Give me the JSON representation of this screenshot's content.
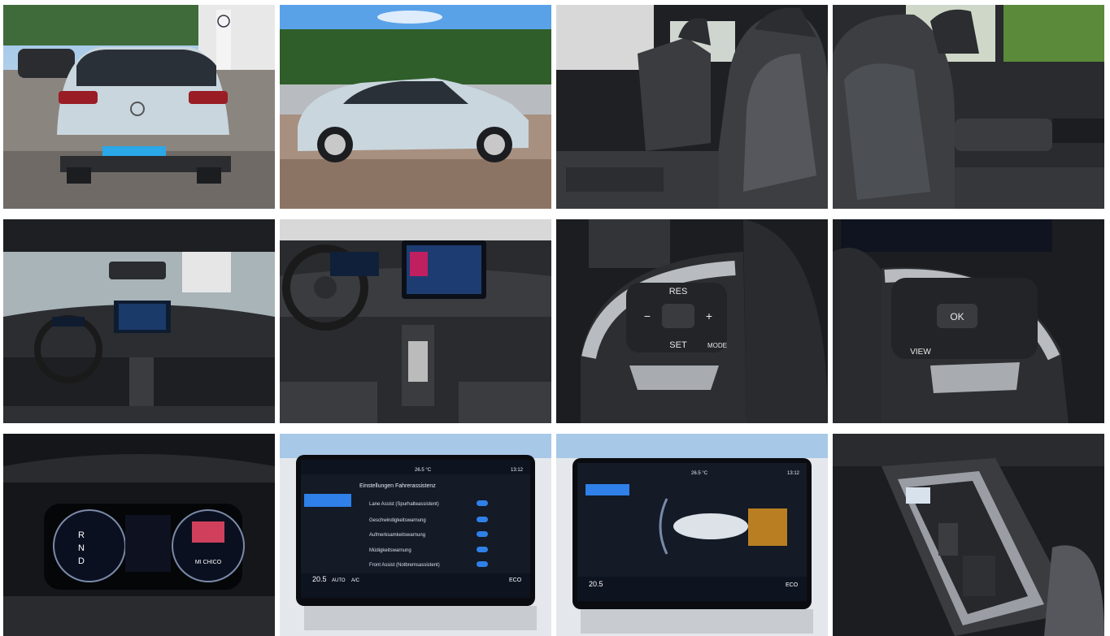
{
  "gallery": {
    "photos": [
      {
        "subject": "rear-exterior",
        "plate_color": "#2aa8e8"
      },
      {
        "subject": "side-exterior"
      },
      {
        "subject": "front-seats-right"
      },
      {
        "subject": "front-seat-passenger"
      },
      {
        "subject": "dashboard-overview"
      },
      {
        "subject": "steering-wheel-and-infotainment"
      },
      {
        "subject": "steering-wheel-left-controls",
        "labels": {
          "res": "RES",
          "set": "SET",
          "mode": "MODE",
          "plus": "+",
          "minus": "−"
        }
      },
      {
        "subject": "steering-wheel-right-controls",
        "labels": {
          "ok": "OK",
          "view": "VIEW"
        }
      },
      {
        "subject": "digital-instrument-cluster",
        "labels": {
          "gears": [
            "R",
            "N",
            "D"
          ],
          "range": "MI CHICO"
        }
      },
      {
        "subject": "infotainment-driver-assist-settings",
        "labels": {
          "header": "Einstellungen Fahrerassistenz",
          "temp": "26.5 °C",
          "time": "13:12",
          "items": [
            "Lane Assist (Spurhalteassistent)",
            "Geschwindigkeitswarnung",
            "Aufmerksamkeitswarnung",
            "Müdigkeitswarnung",
            "Front Assist (Notbremsassistent)"
          ],
          "bottom_temp": "20.5",
          "auto": "AUTO",
          "ac": "A/C",
          "eco": "ECO"
        }
      },
      {
        "subject": "infotainment-park-distance",
        "labels": {
          "temp": "26.5 °C",
          "time": "13:12",
          "bottom_temp": "20.5",
          "eco": "ECO"
        }
      },
      {
        "subject": "center-console-gear-selector"
      }
    ]
  },
  "colors": {
    "car_body": "#c9d6de",
    "interior_dark": "#2b2d31",
    "screen_accent": "#2f80e8",
    "active_toggle": "#2f80e8",
    "park_sensor": "#f0a020"
  }
}
